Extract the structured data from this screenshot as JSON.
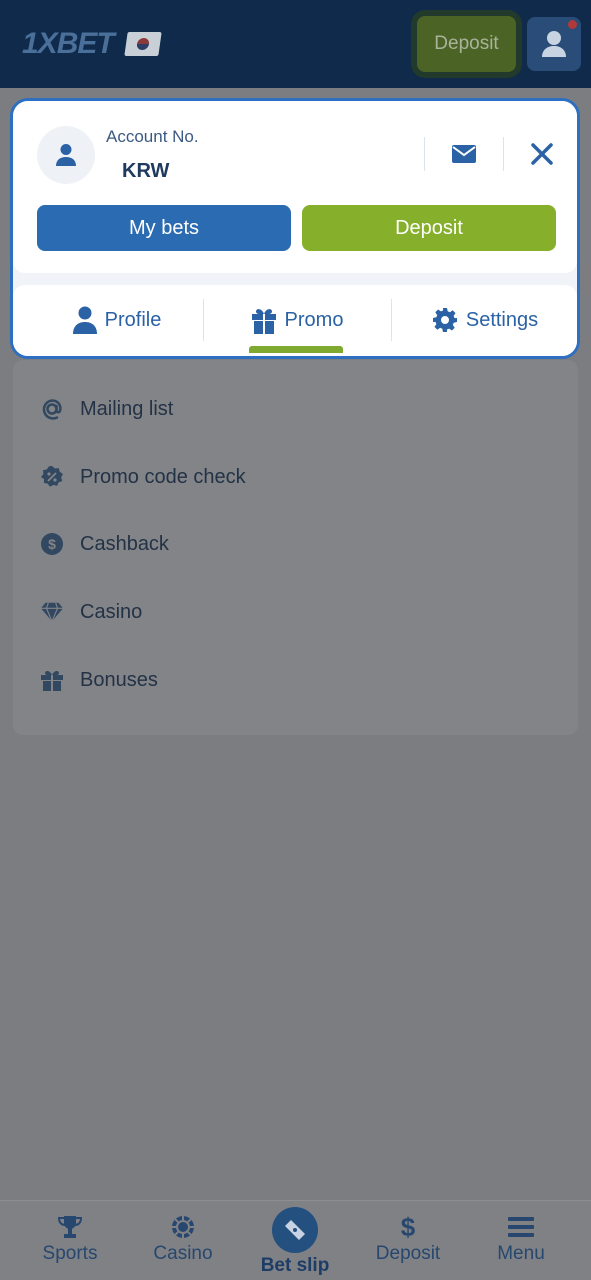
{
  "header": {
    "logo_text": "1XBET",
    "deposit_label": "Deposit"
  },
  "account": {
    "label": "Account No.",
    "currency": "KRW",
    "my_bets_label": "My bets",
    "deposit_label": "Deposit"
  },
  "tabs": [
    {
      "label": "Profile",
      "icon": "user-icon"
    },
    {
      "label": "Promo",
      "icon": "gift-icon",
      "active": true
    },
    {
      "label": "Settings",
      "icon": "gear-icon"
    }
  ],
  "promo_items": [
    {
      "label": "Mailing list",
      "icon": "at-icon"
    },
    {
      "label": "Promo code check",
      "icon": "percent-badge-icon"
    },
    {
      "label": "Cashback",
      "icon": "dollar-circle-icon"
    },
    {
      "label": "Casino",
      "icon": "diamond-icon"
    },
    {
      "label": "Bonuses",
      "icon": "gift-icon"
    }
  ],
  "bottom_nav": [
    {
      "label": "Sports",
      "icon": "trophy-icon"
    },
    {
      "label": "Casino",
      "icon": "chip-icon"
    },
    {
      "label": "Bet slip",
      "icon": "ticket-icon"
    },
    {
      "label": "Deposit",
      "icon": "dollar-icon"
    },
    {
      "label": "Menu",
      "icon": "hamburger-icon"
    }
  ],
  "colors": {
    "header_bg": "#0f2a4a",
    "primary_blue": "#2a6bb2",
    "accent_green": "#86b02b",
    "modal_border": "#2d6fc0",
    "overlay_gray": "#7b7d80"
  }
}
